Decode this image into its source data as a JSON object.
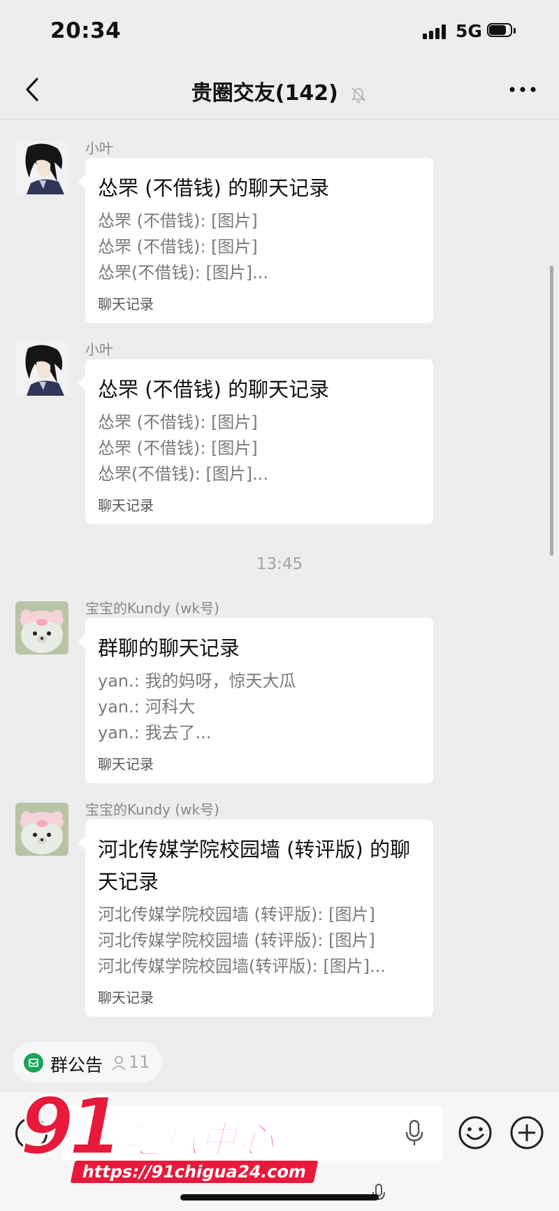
{
  "status": {
    "time": "20:34",
    "network": "5G",
    "battery_level": 0.8
  },
  "nav": {
    "title": "贵圈交友(142)",
    "back_icon": "chevron-left-icon",
    "mute_icon": "bell-off-icon",
    "more_icon": "more-horizontal-icon"
  },
  "messages": [
    {
      "sender": "小叶",
      "avatar_icon": "anime-boy-avatar",
      "title": "怂罘 (不借钱) 的聊天记录",
      "lines": [
        "怂罘 (不借钱): [图片]",
        "怂罘 (不借钱): [图片]",
        "怂罘(不借钱): [图片]..."
      ],
      "footer": "聊天记录"
    },
    {
      "sender": "小叶",
      "avatar_icon": "anime-boy-avatar",
      "title": "怂罘 (不借钱) 的聊天记录",
      "lines": [
        "怂罘 (不借钱): [图片]",
        "怂罘 (不借钱): [图片]",
        "怂罘(不借钱): [图片]..."
      ],
      "footer": "聊天记录"
    },
    {
      "sender": "宝宝的Kundy (wk号)",
      "avatar_icon": "plush-bear-avatar",
      "title": "群聊的聊天记录",
      "lines": [
        "yan.: 我的妈呀，惊天大瓜",
        "yan.: 河科大",
        "yan.: 我去了..."
      ],
      "footer": "聊天记录"
    },
    {
      "sender": "宝宝的Kundy (wk号)",
      "avatar_icon": "plush-bear-avatar",
      "title": "河北传媒学院校园墙 (转评版) 的聊天记录",
      "lines": [
        "河北传媒学院校园墙 (转评版): [图片]",
        "河北传媒学院校园墙 (转评版): [图片]",
        "河北传媒学院校园墙(转评版): [图片]..."
      ],
      "footer": "聊天记录"
    }
  ],
  "time_separator": "13:45",
  "notice": {
    "label": "群公告",
    "count": "11"
  },
  "input": {
    "value": "",
    "placeholder": ""
  },
  "watermark": {
    "logo": "91",
    "text": "吃瓜中心",
    "url": "https://91chigua24.com"
  },
  "colors": {
    "background": "#ededed",
    "bubble": "#ffffff",
    "notice_green": "#19a45a",
    "watermark_red": "#e8193a"
  }
}
